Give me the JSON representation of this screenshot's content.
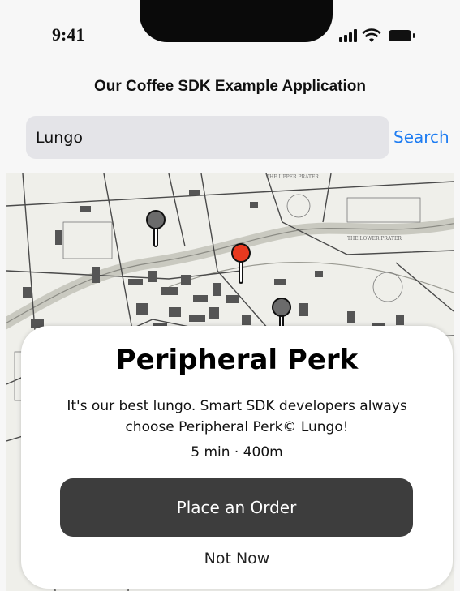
{
  "status_bar": {
    "time": "9:41",
    "icons": [
      "cellular-signal-icon",
      "wifi-icon",
      "battery-icon"
    ]
  },
  "nav": {
    "title": "Our Coffee SDK Example Application"
  },
  "search": {
    "value": "Lungo",
    "button_label": "Search"
  },
  "map": {
    "pins": [
      {
        "name": "map-pin-gray",
        "color": "#6b6b6b"
      },
      {
        "name": "map-pin-selected",
        "color": "#e8391f"
      },
      {
        "name": "map-pin-gray",
        "color": "#6b6b6b"
      }
    ]
  },
  "card": {
    "title": "Peripheral Perk",
    "description": "It's our best lungo. Smart SDK developers always choose Peripheral Perk© Lungo!",
    "meta": "5 min · 400m",
    "primary_label": "Place an Order",
    "secondary_label": "Not Now"
  },
  "colors": {
    "accent": "#1d7cf2",
    "button_dark": "#3d3d3d",
    "pin_selected": "#e8391f",
    "pin_default": "#6b6b6b"
  }
}
